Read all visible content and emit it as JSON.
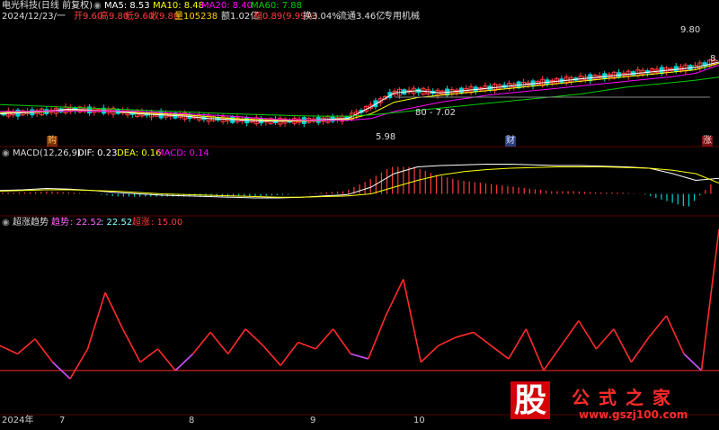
{
  "header": {
    "stock_name": "电光科技(日线 前复权)",
    "ma5": "MA5: 8.53",
    "ma10": "MA10: 8.48",
    "ma20": "MA20: 8.40",
    "ma60": "MA60: 7.88",
    "date": "2024/12/23/一",
    "open": "开9.60",
    "high": "高9.80",
    "low": "低9.60",
    "close": "收9.80",
    "volume": "量105238",
    "amount": "额1.02亿",
    "change": "幅0.89(9.99%)",
    "turnover": "换3.04%",
    "float_cap": "流通3.46亿",
    "sector": "专用机械"
  },
  "price_labels": {
    "high_mark": "9.80",
    "right_edge": "8.",
    "mid_mark": "80 - 7.02",
    "low_mark": "5.98"
  },
  "markers": {
    "left": "购",
    "middle": "财",
    "right": "涨"
  },
  "macd_header": {
    "name": "MACD(12,26,9)",
    "dif": "DIF: 0.23",
    "dea": "DEA: 0.16",
    "macd": "MACD: 0.14"
  },
  "indicator_header": {
    "name": "超涨趋势",
    "trend_label": "趋势",
    "trend_value": ": 22.52",
    "trend_value2": ": 22.52",
    "super_label": "超涨",
    "super_value": ": 15.00"
  },
  "x_axis": {
    "labels": [
      "2024年",
      "7",
      "8",
      "9",
      "10"
    ]
  },
  "watermark": {
    "big": "股",
    "cn": "公式之家",
    "url": "www.gszj100.com"
  },
  "chart_data": [
    {
      "type": "line",
      "title": "电光科技(日线 前复权)",
      "series": [
        {
          "name": "MA5",
          "values": [
            6.3,
            6.35,
            6.4,
            6.5,
            6.45,
            6.4,
            6.3,
            6.25,
            6.2,
            6.1,
            6.05,
            6.0,
            5.98,
            6.0,
            6.05,
            6.1,
            6.6,
            7.2,
            7.3,
            7.2,
            7.3,
            7.4,
            7.5,
            7.6,
            7.7,
            7.8,
            7.9,
            8.0,
            8.1,
            8.2,
            8.3,
            8.53
          ]
        },
        {
          "name": "MA10",
          "values": [
            6.35,
            6.38,
            6.4,
            6.45,
            6.44,
            6.42,
            6.35,
            6.3,
            6.25,
            6.18,
            6.1,
            6.05,
            6.02,
            6.0,
            6.02,
            6.05,
            6.3,
            6.8,
            7.0,
            7.1,
            7.2,
            7.3,
            7.4,
            7.5,
            7.6,
            7.7,
            7.8,
            7.9,
            8.0,
            8.1,
            8.2,
            8.48
          ]
        },
        {
          "name": "MA20",
          "values": [
            6.4,
            6.4,
            6.42,
            6.43,
            6.43,
            6.42,
            6.4,
            6.36,
            6.3,
            6.25,
            6.2,
            6.12,
            6.06,
            6.03,
            6.02,
            6.02,
            6.1,
            6.4,
            6.6,
            6.8,
            6.95,
            7.1,
            7.2,
            7.3,
            7.4,
            7.5,
            7.6,
            7.7,
            7.8,
            7.9,
            8.05,
            8.4
          ]
        },
        {
          "name": "MA60",
          "values": [
            6.7,
            6.66,
            6.62,
            6.58,
            6.54,
            6.5,
            6.46,
            6.42,
            6.38,
            6.34,
            6.3,
            6.27,
            6.24,
            6.21,
            6.2,
            6.2,
            6.25,
            6.35,
            6.45,
            6.55,
            6.65,
            6.75,
            6.85,
            6.95,
            7.05,
            7.15,
            7.3,
            7.45,
            7.55,
            7.65,
            7.75,
            7.88
          ]
        }
      ],
      "price_high": 9.8,
      "price_low": 5.98
    },
    {
      "type": "line",
      "title": "MACD(12,26,9)",
      "series": [
        {
          "name": "DIF",
          "values": [
            0.05,
            0.06,
            0.08,
            0.07,
            0.05,
            0.02,
            0.0,
            -0.02,
            -0.03,
            -0.04,
            -0.05,
            -0.06,
            -0.06,
            -0.05,
            -0.03,
            -0.01,
            0.1,
            0.3,
            0.4,
            0.42,
            0.43,
            0.44,
            0.44,
            0.43,
            0.42,
            0.42,
            0.41,
            0.4,
            0.38,
            0.3,
            0.2,
            0.23
          ]
        },
        {
          "name": "DEA",
          "values": [
            0.04,
            0.05,
            0.06,
            0.06,
            0.05,
            0.04,
            0.02,
            0.0,
            -0.01,
            -0.02,
            -0.03,
            -0.04,
            -0.05,
            -0.05,
            -0.04,
            -0.03,
            0.0,
            0.1,
            0.2,
            0.28,
            0.33,
            0.36,
            0.38,
            0.39,
            0.4,
            0.4,
            0.4,
            0.39,
            0.38,
            0.35,
            0.3,
            0.16
          ]
        },
        {
          "name": "MACD",
          "values": [
            0.02,
            0.02,
            0.04,
            0.02,
            0.0,
            -0.04,
            -0.04,
            -0.04,
            -0.04,
            -0.04,
            -0.04,
            -0.04,
            -0.02,
            0.0,
            0.02,
            0.04,
            0.2,
            0.4,
            0.4,
            0.28,
            0.2,
            0.16,
            0.12,
            0.08,
            0.04,
            0.04,
            0.02,
            0.02,
            0.0,
            -0.1,
            -0.2,
            0.14
          ]
        }
      ]
    },
    {
      "type": "line",
      "title": "超涨趋势",
      "series": [
        {
          "name": "趋势",
          "values": [
            30,
            25,
            34,
            20,
            10,
            28,
            62,
            40,
            20,
            28,
            15,
            25,
            38,
            25,
            40,
            30,
            18,
            32,
            28,
            40,
            25,
            22,
            48,
            70,
            20,
            30,
            35,
            38,
            30,
            22,
            40,
            15,
            30,
            45,
            28,
            40,
            20,
            35,
            48,
            25,
            15,
            100
          ]
        },
        {
          "name": "超涨",
          "values": [
            15,
            15,
            15,
            15,
            15,
            15,
            15,
            15,
            15,
            15,
            15,
            15,
            15,
            15,
            15,
            15,
            15,
            15,
            15,
            15,
            15,
            15,
            15,
            15,
            15,
            15,
            15,
            15,
            15,
            15,
            15,
            15,
            15,
            15,
            15,
            15,
            15,
            15,
            15,
            15,
            15,
            15
          ]
        }
      ],
      "ylim": [
        -10,
        100
      ]
    }
  ]
}
